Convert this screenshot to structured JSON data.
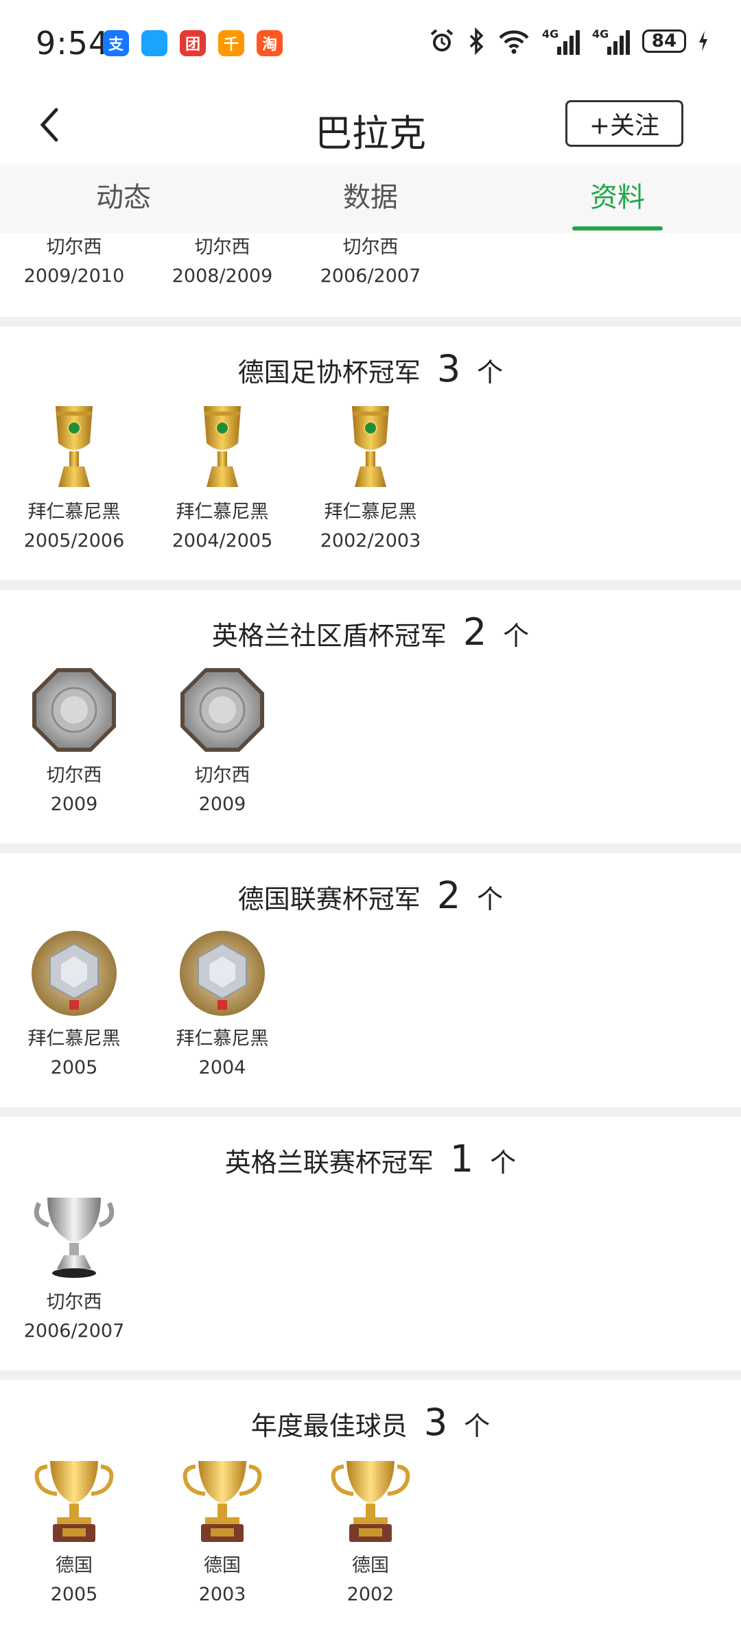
{
  "status_bar": {
    "time": "9:54",
    "apps": [
      {
        "icon": "alipay-icon",
        "glyph": "支",
        "color": "#1677ff"
      },
      {
        "icon": "message-icon",
        "glyph": "",
        "color": "#1aa3ff"
      },
      {
        "icon": "app-red-icon",
        "glyph": "团",
        "color": "#e53935"
      },
      {
        "icon": "app-multicolor-icon",
        "glyph": "千",
        "color": "#ff9800"
      },
      {
        "icon": "taobao-icon",
        "glyph": "淘",
        "color": "#ff5722"
      }
    ],
    "signal_label": "4G",
    "battery": "84"
  },
  "header": {
    "title": "巴拉克",
    "follow_label": "+关注"
  },
  "tabs": [
    {
      "label": "动态"
    },
    {
      "label": "数据"
    },
    {
      "label": "资料"
    }
  ],
  "active_tab": "资料",
  "top_partial": [
    {
      "team": "切尔西",
      "season": "2009/2010"
    },
    {
      "team": "切尔西",
      "season": "2008/2009"
    },
    {
      "team": "切尔西",
      "season": "2006/2007"
    }
  ],
  "sections": [
    {
      "title": "德国足协杯冠军",
      "count": "3",
      "unit": "个",
      "trophy": "dfb-pokal-icon",
      "items": [
        {
          "team": "拜仁慕尼黑",
          "season": "2005/2006"
        },
        {
          "team": "拜仁慕尼黑",
          "season": "2004/2005"
        },
        {
          "team": "拜仁慕尼黑",
          "season": "2002/2003"
        }
      ]
    },
    {
      "title": "英格兰社区盾杯冠军",
      "count": "2",
      "unit": "个",
      "trophy": "community-shield-icon",
      "items": [
        {
          "team": "切尔西",
          "season": "2009"
        },
        {
          "team": "切尔西",
          "season": "2009"
        }
      ]
    },
    {
      "title": "德国联赛杯冠军",
      "count": "2",
      "unit": "个",
      "trophy": "ligapokal-icon",
      "items": [
        {
          "team": "拜仁慕尼黑",
          "season": "2005"
        },
        {
          "team": "拜仁慕尼黑",
          "season": "2004"
        }
      ]
    },
    {
      "title": "英格兰联赛杯冠军",
      "count": "1",
      "unit": "个",
      "trophy": "league-cup-icon",
      "items": [
        {
          "team": "切尔西",
          "season": "2006/2007"
        }
      ]
    },
    {
      "title": "年度最佳球员",
      "count": "3",
      "unit": "个",
      "trophy": "gold-cup-icon",
      "items": [
        {
          "team": "德国",
          "season": "2005"
        },
        {
          "team": "德国",
          "season": "2003"
        },
        {
          "team": "德国",
          "season": "2002"
        }
      ]
    }
  ],
  "colors": {
    "accent": "#1fa64a",
    "tab_bg": "#f7f7f7",
    "separator": "#f0f0f0"
  }
}
